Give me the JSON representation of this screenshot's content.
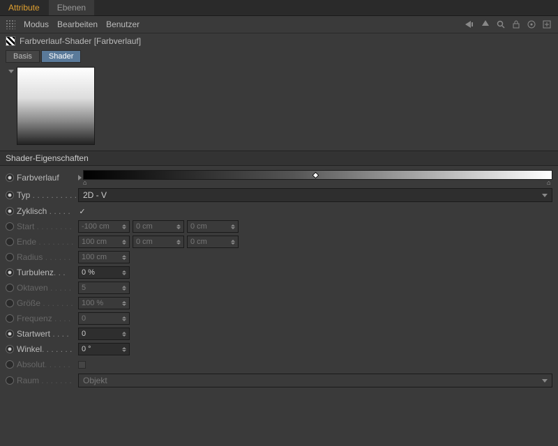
{
  "tabs": {
    "attribute": "Attribute",
    "ebenen": "Ebenen"
  },
  "toolbar": {
    "modus": "Modus",
    "bearbeiten": "Bearbeiten",
    "benutzer": "Benutzer"
  },
  "title": "Farbverlauf-Shader [Farbverlauf]",
  "subtabs": {
    "basis": "Basis",
    "shader": "Shader"
  },
  "section": "Shader-Eigenschaften",
  "props": {
    "farbverlauf": {
      "label": "Farbverlauf"
    },
    "typ": {
      "label": "Typ",
      "value": "2D - V"
    },
    "zyklisch": {
      "label": "Zyklisch",
      "checked": true
    },
    "start": {
      "label": "Start",
      "v1": "-100 cm",
      "v2": "0 cm",
      "v3": "0 cm"
    },
    "ende": {
      "label": "Ende",
      "v1": "100 cm",
      "v2": "0 cm",
      "v3": "0 cm"
    },
    "radius": {
      "label": "Radius",
      "value": "100 cm"
    },
    "turbulenz": {
      "label": "Turbulenz",
      "value": "0 %"
    },
    "oktaven": {
      "label": "Oktaven",
      "value": "5"
    },
    "groesse": {
      "label": "Größe",
      "value": "100 %"
    },
    "frequenz": {
      "label": "Frequenz",
      "value": "0"
    },
    "startwert": {
      "label": "Startwert",
      "value": "0"
    },
    "winkel": {
      "label": "Winkel",
      "value": "0 °"
    },
    "absolut": {
      "label": "Absolut",
      "checked": false
    },
    "raum": {
      "label": "Raum",
      "value": "Objekt"
    }
  }
}
